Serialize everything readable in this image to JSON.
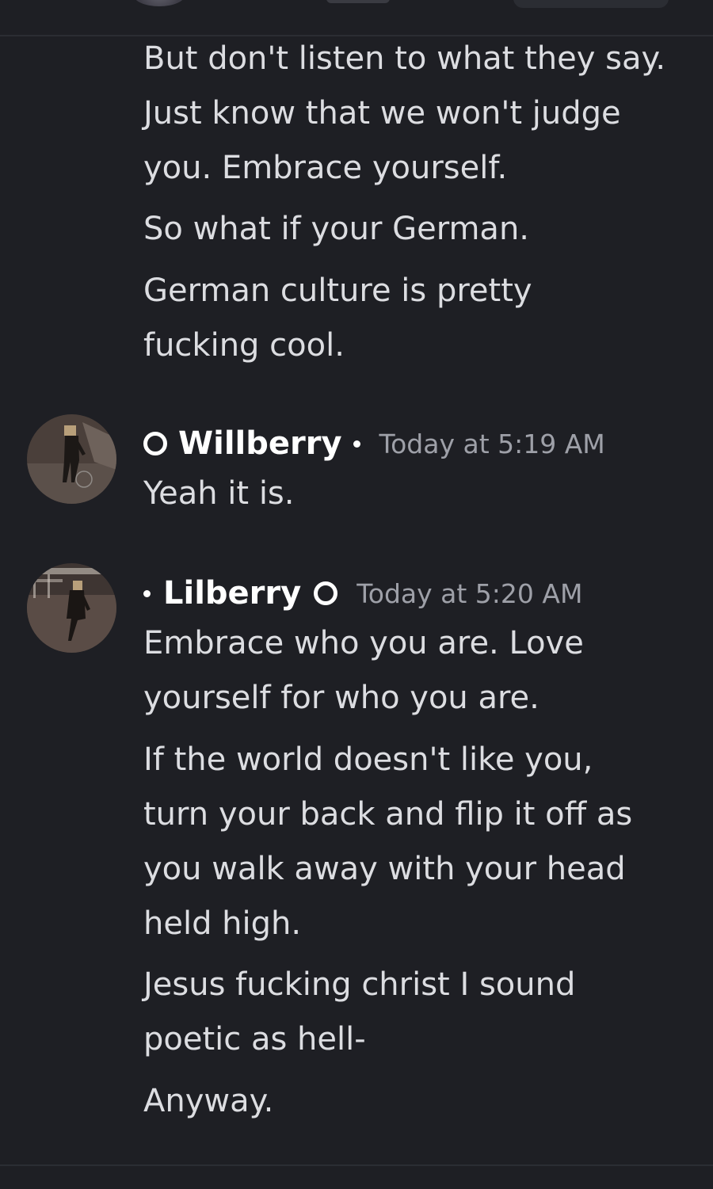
{
  "messages": [
    {
      "lines": [
        "But don't listen to what they say.",
        "Just know that we won't judge",
        "you. Embrace yourself.",
        "So what if your German.",
        "German culture is pretty",
        "fucking cool."
      ]
    },
    {
      "author": "Willberry",
      "timestamp": "Today at 5:19 AM",
      "lines": [
        "Yeah it is."
      ]
    },
    {
      "author": "Lilberry",
      "timestamp": "Today at 5:20 AM",
      "lines": [
        "Embrace who you are. Love",
        "yourself for who you are.",
        "If the world doesn't like you,",
        "turn your back and flip it off as",
        "you walk away with your head",
        "held high.",
        "Jesus fucking christ I sound",
        "poetic as hell-",
        "Anyway."
      ]
    }
  ],
  "colors": {
    "background": "#1e1f24",
    "text": "#dcdde1",
    "author": "#ffffff",
    "timestamp": "#9ea0a8"
  },
  "icons": [
    "ring-icon",
    "dot-icon"
  ]
}
